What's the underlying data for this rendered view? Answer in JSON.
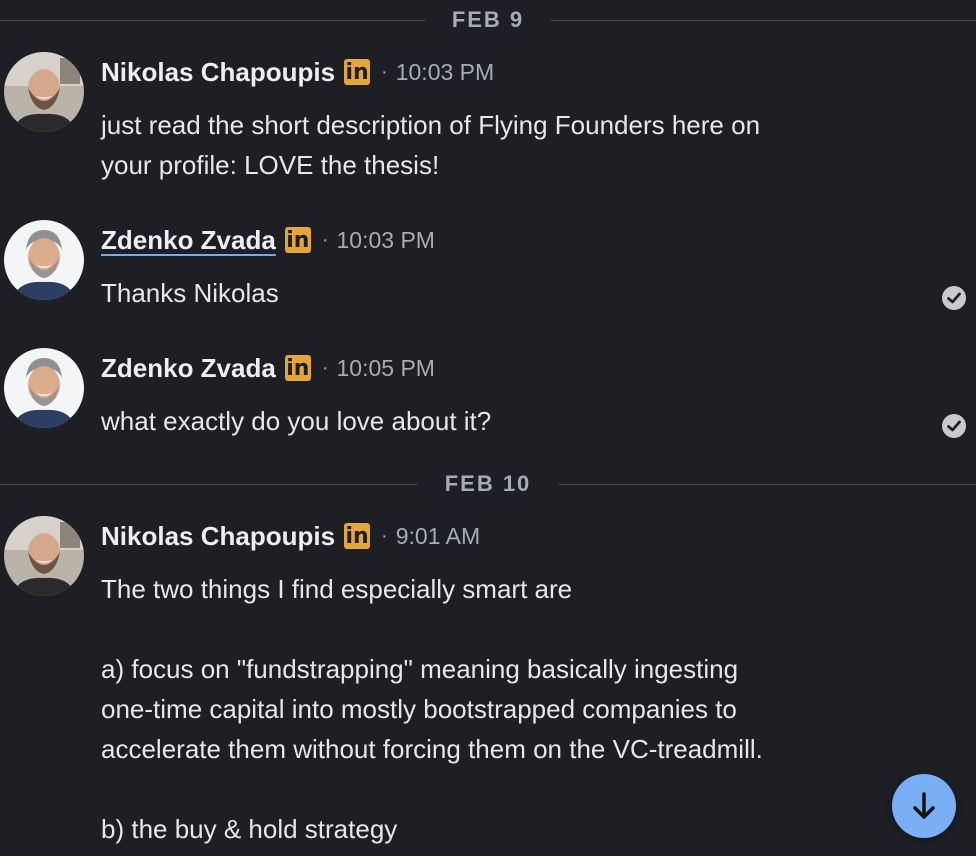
{
  "dividers": {
    "feb9": "FEB 9",
    "feb10": "FEB 10"
  },
  "messages": [
    {
      "sender": "Nikolas Chapoupis",
      "badge": "in",
      "time": "10:03 PM",
      "lines": [
        "just read the short description of Flying Founders here on",
        "your profile: LOVE the thesis!"
      ]
    },
    {
      "sender": "Zdenko Zvada",
      "badge": "in",
      "time": "10:03 PM",
      "lines": [
        "Thanks Nikolas"
      ],
      "read": true
    },
    {
      "sender": "Zdenko Zvada",
      "badge": "in",
      "time": "10:05 PM",
      "lines": [
        "what exactly do you love about it?"
      ],
      "read": true
    },
    {
      "sender": "Nikolas Chapoupis",
      "badge": "in",
      "time": "9:01 AM",
      "lines": [
        "The two things I find especially smart are",
        "a) focus on \"fundstrapping\" meaning basically ingesting",
        "one-time capital into mostly bootstrapped companies to",
        "accelerate them without forcing them on the VC-treadmill.",
        "b) the buy & hold strategy"
      ]
    }
  ],
  "separator_dot": "·",
  "icons": {
    "linkedin": "linkedin-icon",
    "read": "check-circle-icon",
    "scroll": "arrow-down-icon"
  },
  "colors": {
    "background": "#1d1f24",
    "linkedin_badge": "#e6a537",
    "scroll_button": "#7aaef5",
    "link_underline": "#7aa9f0"
  }
}
